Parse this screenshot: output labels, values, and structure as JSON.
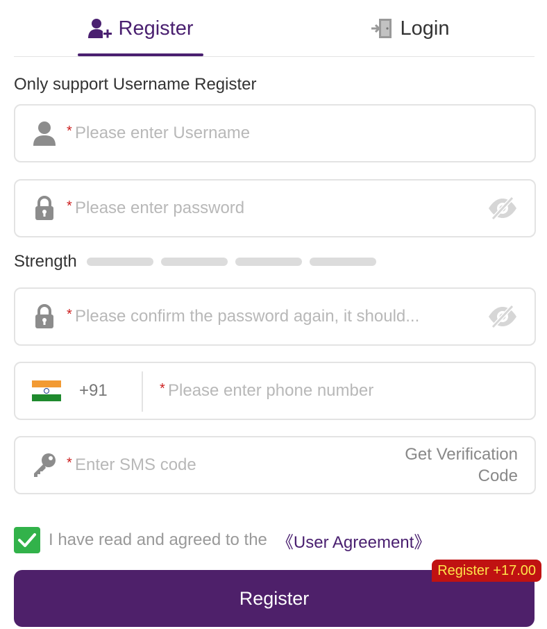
{
  "tabs": {
    "register_label": "Register",
    "login_label": "Login"
  },
  "notice": "Only support Username Register",
  "fields": {
    "required_mark": "*",
    "username_placeholder": "Please enter Username",
    "password_placeholder": "Please enter password",
    "confirm_placeholder": "Please confirm the password again, it should...",
    "phone_placeholder": "Please enter phone number",
    "country_code": "+91",
    "sms_placeholder": "Enter SMS code",
    "get_code_line1": "Get Verification",
    "get_code_line2": "Code"
  },
  "strength": {
    "label": "Strength",
    "filled_segments": 0,
    "total_segments": 4
  },
  "agreement": {
    "checked": true,
    "text": "I have read and agreed to the",
    "link": "《User Agreement》"
  },
  "submit": {
    "label": "Register",
    "bonus": "Register +17.00"
  },
  "colors": {
    "brand": "#4e206a",
    "checkbox": "#32b24a",
    "badge_bg": "#c01212",
    "badge_text": "#ffe44a",
    "required": "#cc1f1f"
  },
  "icons": {
    "register_tab": "user-add-icon",
    "login_tab": "door-enter-icon",
    "username": "user-icon",
    "password": "lock-icon",
    "visibility": "eye-off-icon",
    "country": "india-flag-icon",
    "sms": "key-icon",
    "check": "check-icon"
  }
}
